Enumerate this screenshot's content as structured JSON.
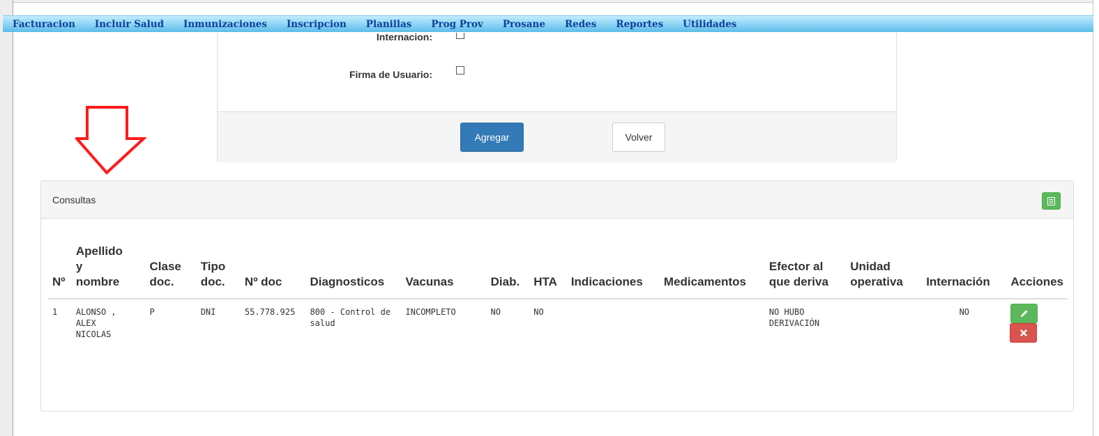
{
  "menu": {
    "items": [
      "Facturacion",
      "Incluir Salud",
      "Inmunizaciones",
      "Inscripcion",
      "Planillas",
      "Prog Prov",
      "Prosane",
      "Redes",
      "Reportes",
      "Utilidades"
    ]
  },
  "form": {
    "internacion_label": "Internacion:",
    "firma_label": "Firma de Usuario:",
    "agregar_label": "Agregar",
    "volver_label": "Volver"
  },
  "consultas": {
    "title": "Consultas",
    "headers": {
      "nro": "Nº",
      "apellido": [
        "Apellido",
        "y",
        "nombre"
      ],
      "clase": [
        "Clase",
        "doc."
      ],
      "tipo": [
        "Tipo",
        "doc."
      ],
      "nro_doc": "Nº doc",
      "diagnosticos": "Diagnosticos",
      "vacunas": "Vacunas",
      "diab": "Diab.",
      "hta": "HTA",
      "indicaciones": "Indicaciones",
      "medicamentos": "Medicamentos",
      "efector": [
        "Efector al",
        "que deriva"
      ],
      "unidad": [
        "Unidad",
        "operativa"
      ],
      "internacion": "Internación",
      "acciones": "Acciones"
    },
    "rows": [
      {
        "nro": "1",
        "apellido": [
          "ALONSO ,",
          "ALEX",
          "NICOLAS"
        ],
        "clase": "P",
        "tipo": "DNI",
        "nro_doc": "55.778.925",
        "diagnosticos": [
          "800 - Control de",
          "salud"
        ],
        "vacunas": "INCOMPLETO",
        "diab": "NO",
        "hta": "NO",
        "indicaciones": "",
        "medicamentos": "",
        "efector": [
          "NO HUBO",
          "DERIVACIÓN"
        ],
        "unidad": "",
        "internacion": "NO"
      }
    ]
  },
  "colors": {
    "menu_text": "#10409a",
    "primary": "#337ab7",
    "success": "#5cb85c",
    "danger": "#d9534f",
    "arrow": "#ff0000"
  },
  "icons": {
    "excel": "table-icon",
    "edit": "pencil-icon",
    "delete": "x-icon",
    "annotation": "down-arrow-icon"
  }
}
